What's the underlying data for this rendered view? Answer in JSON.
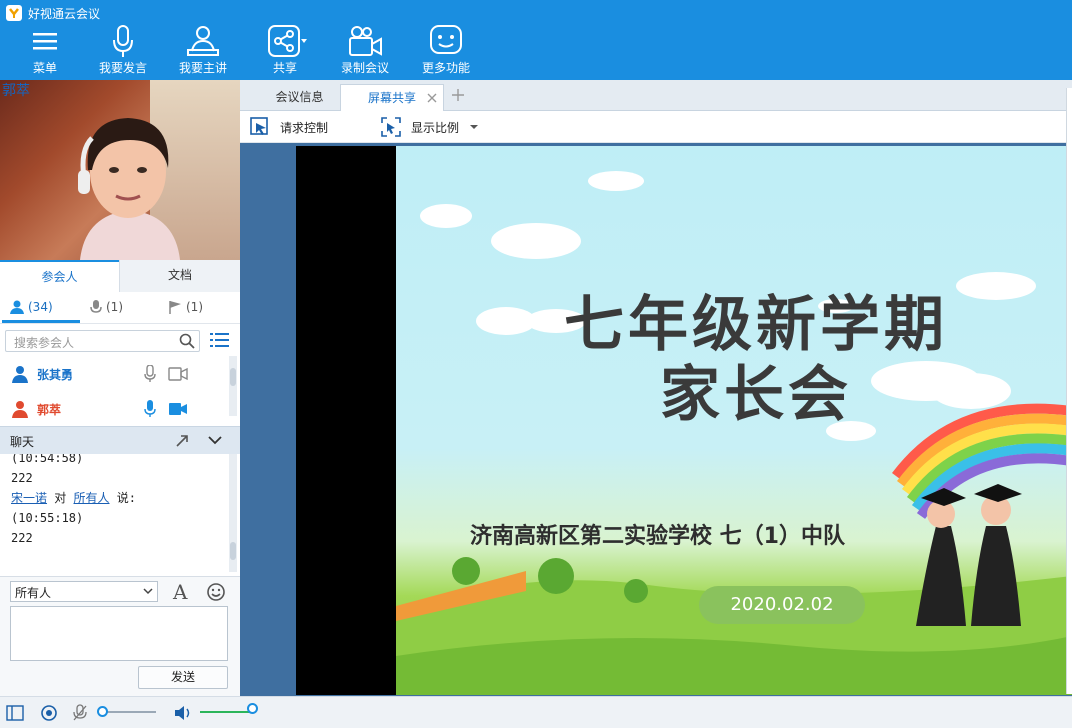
{
  "app": {
    "title": "好视通云会议"
  },
  "toolbar": [
    {
      "label": "菜单",
      "icon": "menu-icon"
    },
    {
      "label": "我要发言",
      "icon": "microphone-icon"
    },
    {
      "label": "我要主讲",
      "icon": "presenter-icon"
    },
    {
      "label": "共享",
      "icon": "share-icon"
    },
    {
      "label": "录制会议",
      "icon": "record-icon"
    },
    {
      "label": "更多功能",
      "icon": "more-icon"
    }
  ],
  "video": {
    "name": "郭萃"
  },
  "left_tabs": [
    {
      "label": "参会人"
    },
    {
      "label": "文档"
    }
  ],
  "counts": {
    "participants": "(34)",
    "speakers": "(1)",
    "flags": "(1)"
  },
  "search": {
    "placeholder": "搜索参会人"
  },
  "participants": [
    {
      "name": "张其勇",
      "color": "#1a73c9"
    },
    {
      "name": "郭萃",
      "color": "#e04a2f"
    }
  ],
  "chat": {
    "title": "聊天",
    "lines": {
      "l0": "(10:54:58)",
      "l1": "222",
      "sender": "宋一诺",
      "to_word": "对",
      "recipient": "所有人",
      "says": "说:",
      "l3": "(10:55:18)",
      "l4": "222"
    },
    "recipient_select": "所有人",
    "send_label": "发送"
  },
  "right_tabs": [
    {
      "label": "会议信息"
    },
    {
      "label": "屏幕共享"
    }
  ],
  "share_toolbar": {
    "request_control": "请求控制",
    "display_ratio": "显示比例"
  },
  "slide": {
    "title_line1": "七年级新学期",
    "title_line2": "家长会",
    "school": "济南高新区第二实验学校  七（1）中队",
    "date": "2020.02.02"
  },
  "colors": {
    "accent": "#1a8ee0",
    "link": "#1a5fb4"
  }
}
